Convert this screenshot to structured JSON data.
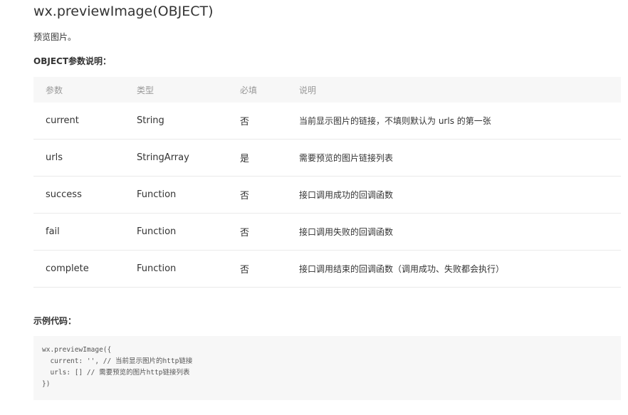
{
  "title": "wx.previewImage(OBJECT)",
  "description": "预览图片。",
  "params_heading": "OBJECT参数说明：",
  "table": {
    "headers": [
      "参数",
      "类型",
      "必填",
      "说明"
    ],
    "rows": [
      {
        "name": "current",
        "type": "String",
        "required": "否",
        "desc": "当前显示图片的链接，不填则默认为 urls 的第一张"
      },
      {
        "name": "urls",
        "type": "StringArray",
        "required": "是",
        "desc": "需要预览的图片链接列表"
      },
      {
        "name": "success",
        "type": "Function",
        "required": "否",
        "desc": "接口调用成功的回调函数"
      },
      {
        "name": "fail",
        "type": "Function",
        "required": "否",
        "desc": "接口调用失败的回调函数"
      },
      {
        "name": "complete",
        "type": "Function",
        "required": "否",
        "desc": "接口调用结束的回调函数（调用成功、失败都会执行）"
      }
    ]
  },
  "example_heading": "示例代码：",
  "code_lines": [
    "wx.previewImage({",
    "  current: '', // 当前显示图片的http链接",
    "  urls: [] // 需要预览的图片http链接列表",
    "})"
  ]
}
